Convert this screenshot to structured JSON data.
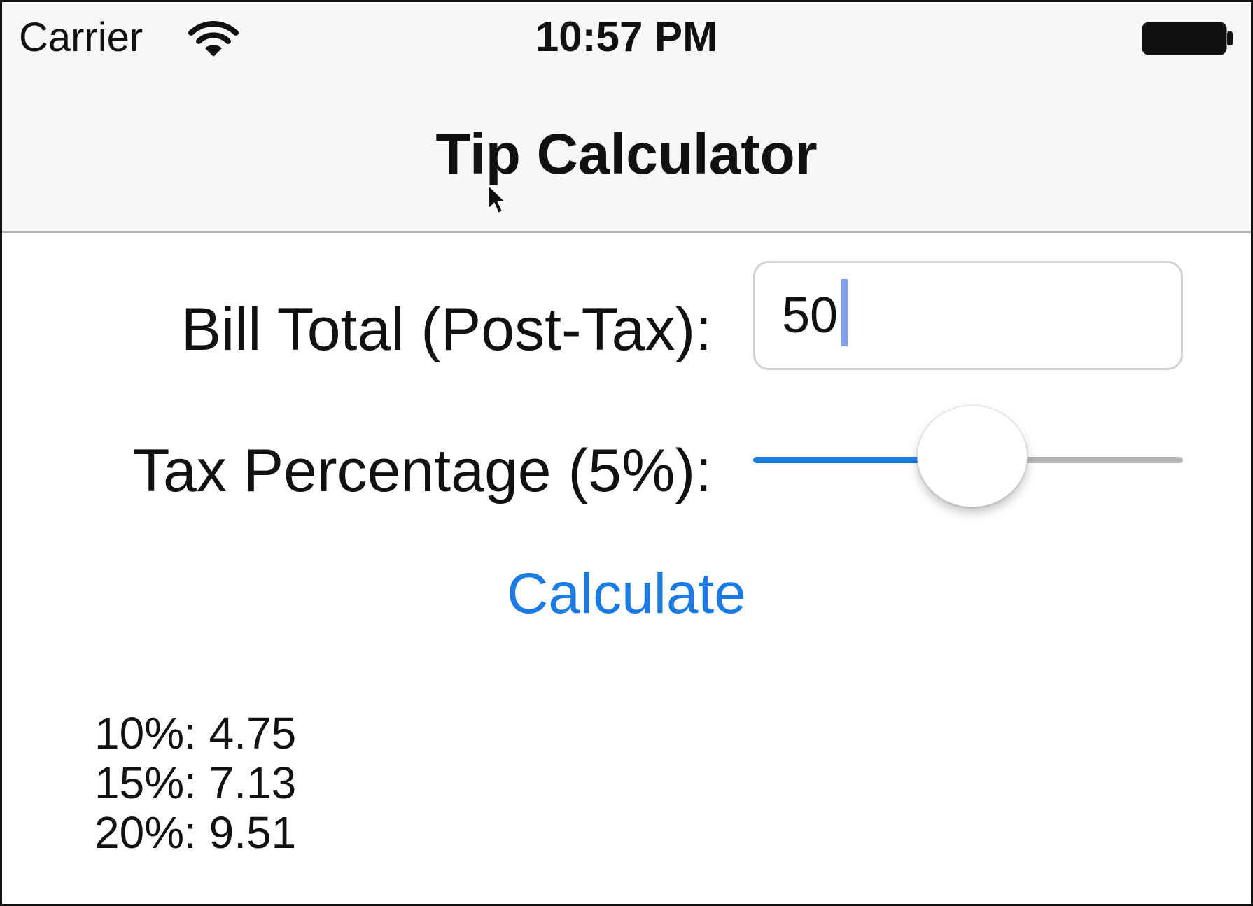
{
  "status_bar": {
    "carrier": "Carrier",
    "time": "10:57 PM",
    "icons": [
      "wifi-icon",
      "battery-icon"
    ]
  },
  "nav_bar": {
    "title": "Tip Calculator"
  },
  "bill": {
    "label": "Bill Total (Post-Tax):",
    "value": "50",
    "placeholder": ""
  },
  "tax": {
    "label": "Tax Percentage (5%):",
    "slider_fraction": 0.51
  },
  "calculate_button": {
    "label": "Calculate"
  },
  "results": [
    {
      "text": "10%: 4.75"
    },
    {
      "text": "15%: 7.13"
    },
    {
      "text": "20%: 9.51"
    }
  ],
  "colors": {
    "accent": "#1a7be6",
    "bar_background": "#f7f7f7",
    "track_inactive": "#b8b8b8"
  }
}
